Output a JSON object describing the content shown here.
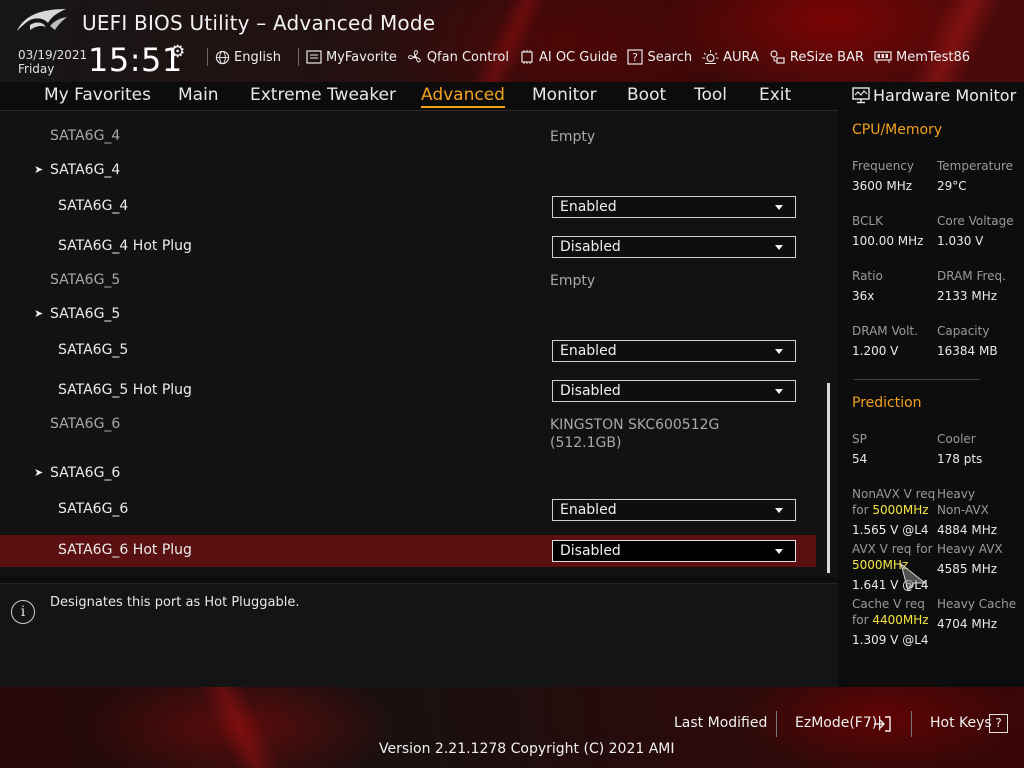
{
  "header": {
    "title": "UEFI BIOS Utility – Advanced Mode",
    "date": "03/19/2021",
    "day": "Friday",
    "time": "15:51",
    "toolbar": [
      {
        "label": "English",
        "icon": "globe-icon"
      },
      {
        "label": "MyFavorite",
        "icon": "favorite-icon"
      },
      {
        "label": "Qfan Control",
        "icon": "fan-icon"
      },
      {
        "label": "AI OC Guide",
        "icon": "chip-icon"
      },
      {
        "label": "Search",
        "icon": "search-icon"
      },
      {
        "label": "AURA",
        "icon": "aura-icon"
      },
      {
        "label": "ReSize BAR",
        "icon": "resize-bar-icon"
      },
      {
        "label": "MemTest86",
        "icon": "memory-icon"
      }
    ]
  },
  "nav": {
    "tabs": [
      "My Favorites",
      "Main",
      "Extreme Tweaker",
      "Advanced",
      "Monitor",
      "Boot",
      "Tool",
      "Exit"
    ],
    "active": "Advanced"
  },
  "main": {
    "rows": [
      {
        "type": "info",
        "label": "SATA6G_4",
        "value": "Empty"
      },
      {
        "type": "submenu",
        "label": "SATA6G_4"
      },
      {
        "type": "select",
        "label": "SATA6G_4",
        "value": "Enabled"
      },
      {
        "type": "select",
        "label": "SATA6G_4 Hot Plug",
        "value": "Disabled"
      },
      {
        "type": "info",
        "label": "SATA6G_5",
        "value": "Empty"
      },
      {
        "type": "submenu",
        "label": "SATA6G_5"
      },
      {
        "type": "select",
        "label": "SATA6G_5",
        "value": "Enabled"
      },
      {
        "type": "select",
        "label": "SATA6G_5 Hot Plug",
        "value": "Disabled"
      },
      {
        "type": "info",
        "label": "SATA6G_6",
        "value": "KINGSTON SKC600512G",
        "value2": "(512.1GB)"
      },
      {
        "type": "submenu",
        "label": "SATA6G_6"
      },
      {
        "type": "select",
        "label": "SATA6G_6",
        "value": "Enabled"
      },
      {
        "type": "select",
        "label": "SATA6G_6 Hot Plug",
        "value": "Disabled",
        "selected": true
      }
    ]
  },
  "help": {
    "text": "Designates this port as Hot Pluggable."
  },
  "hwmon": {
    "title": "Hardware Monitor",
    "cpu_section": "CPU/Memory",
    "cpu": [
      {
        "label": "Frequency",
        "value": "3600 MHz"
      },
      {
        "label": "Temperature",
        "value": "29°C"
      },
      {
        "label": "BCLK",
        "value": "100.00 MHz"
      },
      {
        "label": "Core Voltage",
        "value": "1.030 V"
      },
      {
        "label": "Ratio",
        "value": "36x"
      },
      {
        "label": "DRAM Freq.",
        "value": "2133 MHz"
      },
      {
        "label": "DRAM Volt.",
        "value": "1.200 V"
      },
      {
        "label": "Capacity",
        "value": "16384 MB"
      }
    ],
    "prediction_section": "Prediction",
    "prediction": {
      "sp_label": "SP",
      "sp_value": "54",
      "cooler_label": "Cooler",
      "cooler_value": "178 pts",
      "nonavx_label1": "NonAVX V req",
      "nonavx_for": "for",
      "nonavx_freq": "5000MHz",
      "nonavx_value": "1.565 V @L4",
      "heavy_nonavx_label1": "Heavy",
      "heavy_nonavx_label2": "Non-AVX",
      "heavy_nonavx_value": "4884 MHz",
      "avx_label": "AVX V req",
      "avx_for": "for",
      "avx_freq": "5000MHz",
      "avx_value": "1.641 V @L4",
      "heavy_avx_label": "Heavy AVX",
      "heavy_avx_value": "4585 MHz",
      "cache_label": "Cache V req",
      "cache_for": "for",
      "cache_freq": "4400MHz",
      "cache_value": "1.309 V @L4",
      "heavy_cache_label": "Heavy Cache",
      "heavy_cache_value": "4704 MHz"
    }
  },
  "footer": {
    "last_modified": "Last Modified",
    "ezmode": "EzMode(F7)|",
    "hotkeys": "Hot Keys",
    "hotkeys_icon": "?",
    "version": "Version 2.21.1278 Copyright (C) 2021 AMI"
  },
  "colors": {
    "accent": "#f2a01e",
    "highlight": "#f5e642",
    "selected_row": "#5a1010"
  }
}
